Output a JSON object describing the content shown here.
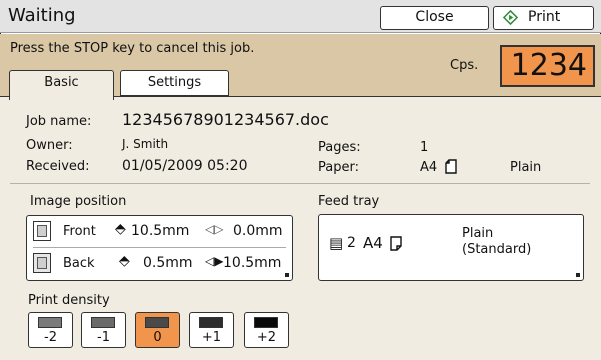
{
  "title": "Waiting",
  "buttons": {
    "close": "Close",
    "print": "Print"
  },
  "message": "Press the STOP key to cancel this job.",
  "counter": {
    "label": "Cps.",
    "value": "1234"
  },
  "tabs": [
    {
      "label": "Basic",
      "active": true
    },
    {
      "label": "Settings",
      "active": false
    }
  ],
  "job": {
    "name_label": "Job name:",
    "name": "12345678901234567.doc",
    "owner_label": "Owner:",
    "owner": "J. Smith",
    "received_label": "Received:",
    "received": "01/05/2009 05:20",
    "pages_label": "Pages:",
    "pages": "1",
    "paper_label": "Paper:",
    "paper_size": "A4",
    "paper_type": "Plain"
  },
  "image_position": {
    "label": "Image position",
    "front": {
      "label": "Front",
      "vertical": "10.5mm",
      "horizontal": "0.0mm"
    },
    "back": {
      "label": "Back",
      "vertical": "0.5mm",
      "horizontal": "10.5mm"
    }
  },
  "feed_tray": {
    "label": "Feed tray",
    "tray": "2",
    "size": "A4",
    "paper_line1": "Plain",
    "paper_line2": "(Standard)"
  },
  "print_density": {
    "label": "Print density",
    "options": [
      {
        "label": "-2",
        "swatch": "#7a7a7a"
      },
      {
        "label": "-1",
        "swatch": "#6a6a6a"
      },
      {
        "label": "0",
        "swatch": "#4a4a4a",
        "active": true
      },
      {
        "label": "+1",
        "swatch": "#2d2d2d"
      },
      {
        "label": "+2",
        "swatch": "#0a0a0a"
      }
    ]
  },
  "colors": {
    "accent_orange": "#f2954c",
    "band_tan": "#d9c7a6",
    "panel_bg": "#f1ece2"
  }
}
